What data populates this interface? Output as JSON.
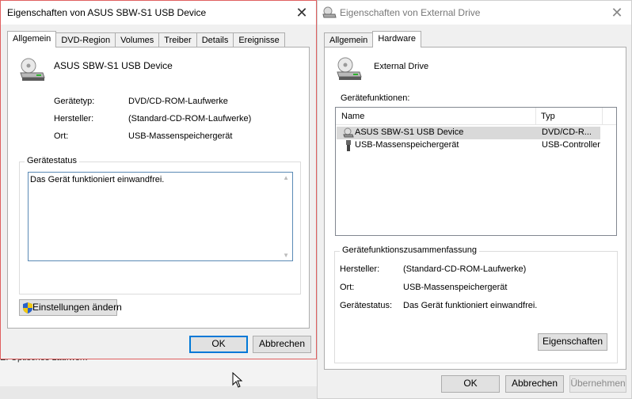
{
  "background": {
    "partial_text": "E:   Optisches Laufwerk"
  },
  "dialog1": {
    "title": "Eigenschaften von ASUS SBW-S1 USB Device",
    "tabs": [
      "Allgemein",
      "DVD-Region",
      "Volumes",
      "Treiber",
      "Details",
      "Ereignisse"
    ],
    "device_name": "ASUS SBW-S1 USB Device",
    "props": [
      {
        "label": "Gerätetyp:",
        "value": "DVD/CD-ROM-Laufwerke"
      },
      {
        "label": "Hersteller:",
        "value": "(Standard-CD-ROM-Laufwerke)"
      },
      {
        "label": "Ort:",
        "value": "USB-Massenspeichergerät"
      }
    ],
    "status_group": "Gerätestatus",
    "status_text": "Das Gerät funktioniert einwandfrei.",
    "change_settings": "Einstellungen ändern",
    "ok": "OK",
    "cancel": "Abbrechen"
  },
  "dialog2": {
    "title": "Eigenschaften von External Drive",
    "tabs": [
      "Allgemein",
      "Hardware"
    ],
    "device_name": "External Drive",
    "functions_label": "Gerätefunktionen:",
    "columns": [
      "Name",
      "Typ"
    ],
    "rows": [
      {
        "name": "ASUS SBW-S1 USB Device",
        "type": "DVD/CD-R...",
        "selected": true
      },
      {
        "name": "USB-Massenspeichergerät",
        "type": "USB-Controller",
        "selected": false
      }
    ],
    "summary_group": "Gerätefunktionszusammenfassung",
    "summary": [
      {
        "label": "Hersteller:",
        "value": "(Standard-CD-ROM-Laufwerke)"
      },
      {
        "label": "Ort:",
        "value": "USB-Massenspeichergerät"
      },
      {
        "label": "Gerätestatus:",
        "value": "Das Gerät funktioniert einwandfrei."
      }
    ],
    "properties_button": "Eigenschaften",
    "ok": "OK",
    "cancel": "Abbrechen",
    "apply": "Übernehmen"
  }
}
